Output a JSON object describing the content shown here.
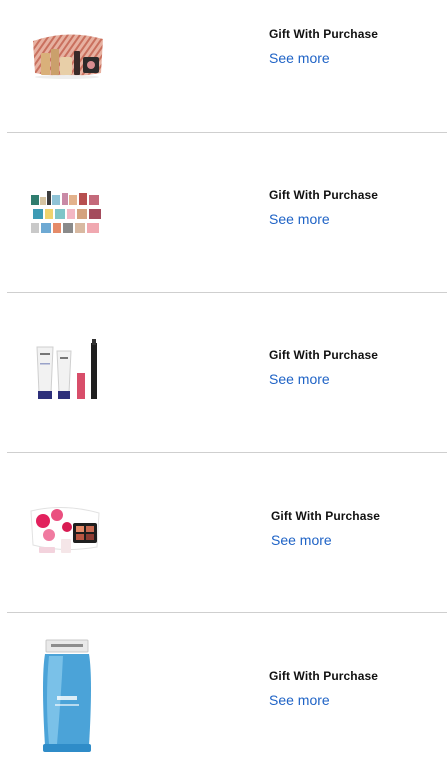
{
  "gifts": [
    {
      "title": "Gift With Purchase",
      "link": "See more",
      "image": "pink-striped-cosmetic-bag-set"
    },
    {
      "title": "Gift With Purchase",
      "link": "See more",
      "image": "deluxe-sample-collection"
    },
    {
      "title": "Gift With Purchase",
      "link": "See more",
      "image": "lancome-tubes-and-mascara"
    },
    {
      "title": "Gift With Purchase",
      "link": "See more",
      "image": "floral-bag-and-palette-set"
    },
    {
      "title": "Gift With Purchase",
      "link": "See more",
      "image": "lancome-bi-facil-bottle"
    }
  ],
  "colors": {
    "link": "#1f63c6",
    "title": "#111111",
    "divider": "#cfcfcf"
  }
}
